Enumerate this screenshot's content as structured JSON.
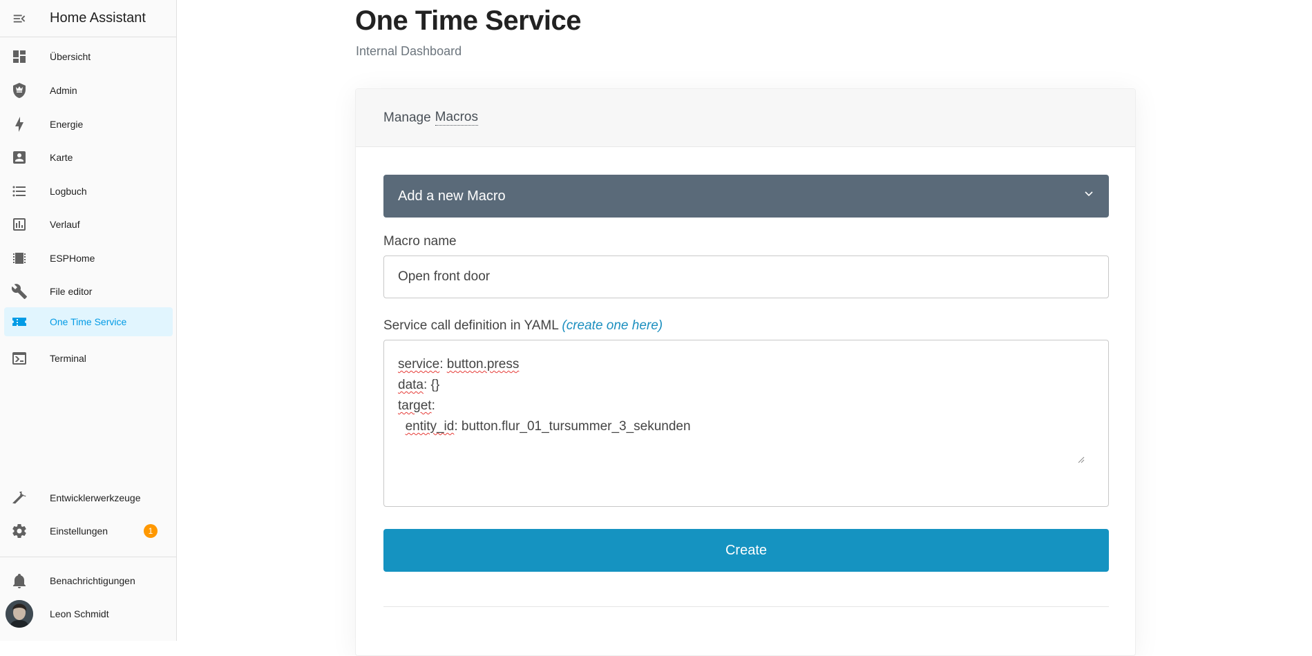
{
  "sidebar": {
    "title": "Home Assistant",
    "items": [
      {
        "label": "Übersicht",
        "icon": "dashboard-icon"
      },
      {
        "label": "Admin",
        "icon": "shield-crown-icon"
      },
      {
        "label": "Energie",
        "icon": "lightning-bolt-icon"
      },
      {
        "label": "Karte",
        "icon": "account-box-icon"
      },
      {
        "label": "Logbuch",
        "icon": "format-list-icon"
      },
      {
        "label": "Verlauf",
        "icon": "chart-box-icon"
      },
      {
        "label": "ESPHome",
        "icon": "chip-icon"
      },
      {
        "label": "File editor",
        "icon": "wrench-icon"
      },
      {
        "label": "One Time Service",
        "icon": "ticket-icon",
        "active": true
      },
      {
        "label": "Terminal",
        "icon": "console-icon"
      }
    ],
    "bottom_items": [
      {
        "label": "Entwicklerwerkzeuge",
        "icon": "hammer-icon"
      },
      {
        "label": "Einstellungen",
        "icon": "cog-icon",
        "badge": "1"
      }
    ],
    "notifications": {
      "label": "Benachrichtigungen",
      "icon": "bell-icon"
    },
    "user": {
      "name": "Leon Schmidt"
    },
    "accent_color": "#039be5",
    "badge_color": "#ff9800"
  },
  "main": {
    "title": "One Time Service",
    "subtitle": "Internal Dashboard",
    "card": {
      "header_prefix": "Manage",
      "header_link": "Macros",
      "accordion_label": "Add a new Macro",
      "macro_name_label": "Macro name",
      "macro_name_value": "Open front door",
      "yaml_label": "Service call definition in YAML",
      "yaml_link": "(create one here)",
      "yaml_lines": {
        "l1_key": "service",
        "l1_val": "button.press",
        "l2_key": "data",
        "l2_val": "{}",
        "l3_key": "target",
        "l4_key": "entity_id",
        "l4_val": "button.flur_01_tursummer_3_sekunden"
      },
      "create_label": "Create",
      "accordion_color": "#5a6a79",
      "button_color": "#1593c1"
    }
  }
}
